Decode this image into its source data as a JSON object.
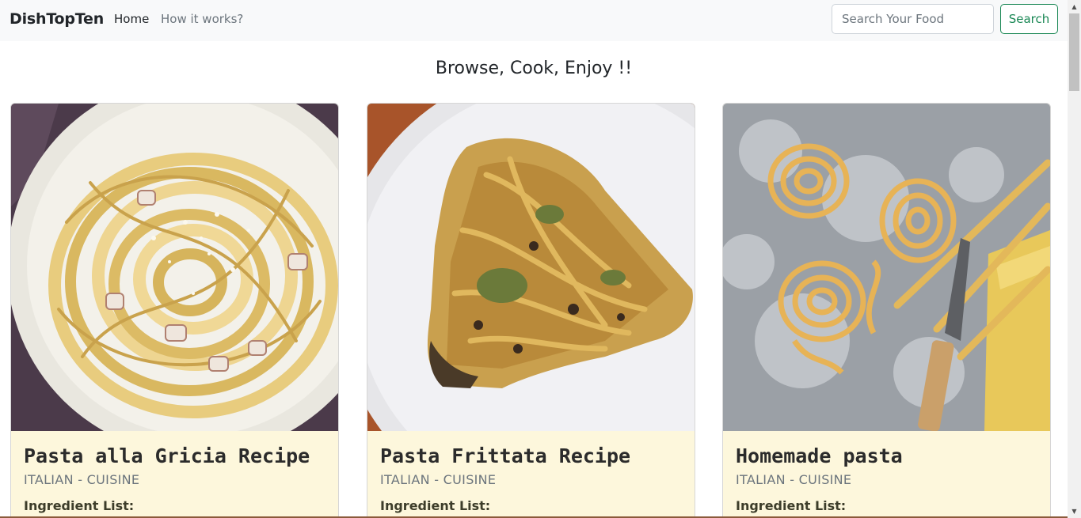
{
  "navbar": {
    "brand": "DishTopTen",
    "links": [
      {
        "label": "Home",
        "active": true
      },
      {
        "label": "How it works?",
        "active": false
      }
    ],
    "search": {
      "placeholder": "Search Your Food",
      "value": "",
      "button_label": "Search"
    }
  },
  "page": {
    "heading": "Browse, Cook, Enjoy !!"
  },
  "cards": [
    {
      "title": "Pasta alla Gricia Recipe",
      "subtitle": "ITALIAN - CUISINE",
      "ingredients_label": "Ingredient List:",
      "image": "spaghetti-plate"
    },
    {
      "title": "Pasta Frittata Recipe",
      "subtitle": "ITALIAN - CUISINE",
      "ingredients_label": "Ingredient List:",
      "image": "frittata-slice"
    },
    {
      "title": "Homemade pasta",
      "subtitle": "ITALIAN - CUISINE",
      "ingredients_label": "Ingredient List:",
      "image": "fresh-pasta-nests"
    }
  ],
  "colors": {
    "navbar_bg": "#f8f9fa",
    "search_button": "#198754",
    "card_body_bg": "#fdf7dc"
  }
}
